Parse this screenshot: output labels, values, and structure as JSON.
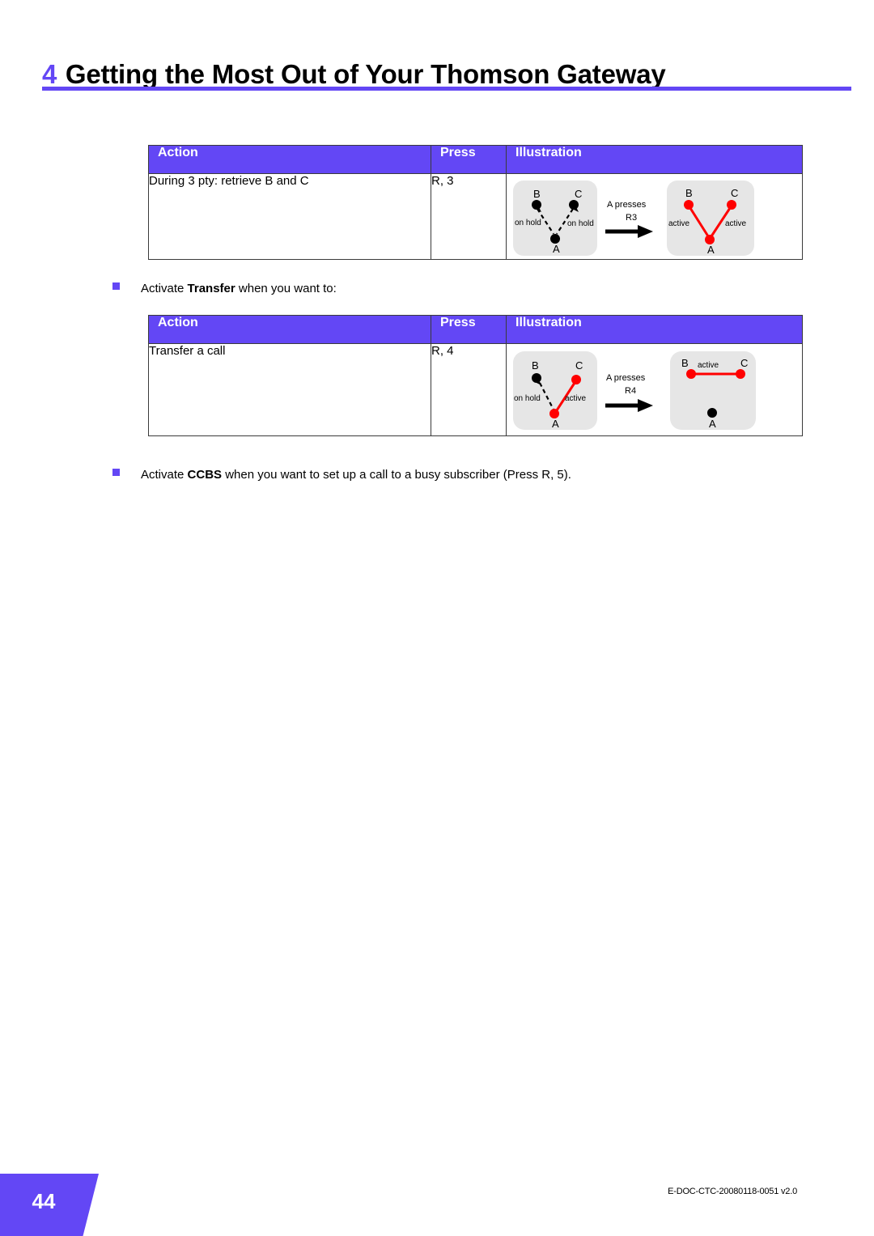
{
  "header": {
    "chapter_number": "4",
    "title": "Getting the Most Out of Your Thomson Gateway",
    "accent_color": "#6347F5"
  },
  "tables": [
    {
      "id": "table-1",
      "columns": [
        "Action",
        "Press",
        "Illustration"
      ],
      "rows": [
        {
          "action": "During 3 pty: retrieve B and C",
          "press": "R, 3",
          "illustration": {
            "before": {
              "nodes": [
                "B",
                "C",
                "A"
              ],
              "edge_labels": [
                "on hold",
                "on hold"
              ],
              "state": "B and C on hold with A"
            },
            "transition": {
              "line1": "A presses",
              "line2": "R3"
            },
            "after": {
              "nodes": [
                "B",
                "C",
                "A"
              ],
              "edge_labels": [
                "active",
                "active"
              ],
              "state": "B and C active with A"
            }
          }
        }
      ]
    },
    {
      "id": "table-2",
      "columns": [
        "Action",
        "Press",
        "Illustration"
      ],
      "rows": [
        {
          "action": "Transfer a call",
          "press": "R, 4",
          "illustration": {
            "before": {
              "nodes": [
                "B",
                "C",
                "A"
              ],
              "edge_labels": [
                "on hold",
                "active"
              ],
              "state": "B on hold, C active with A"
            },
            "transition": {
              "line1": "A presses",
              "line2": "R4"
            },
            "after": {
              "nodes": [
                "B",
                "C",
                "A"
              ],
              "edge_labels": [
                "active"
              ],
              "state": "B and C active, A released"
            }
          }
        }
      ]
    }
  ],
  "bullets": [
    {
      "prefix": "Activate ",
      "emphasis": "Transfer",
      "suffix": " when you want to:"
    },
    {
      "prefix": "Activate ",
      "emphasis": "CCBS",
      "suffix": " when you want to set up a call to a busy subscriber (Press R, 5)."
    }
  ],
  "footer": {
    "page_number": "44",
    "doc_reference": "E-DOC-CTC-20080118-0051 v2.0"
  },
  "colors": {
    "accent_purple": "#6347F5",
    "active_red": "#FF0000",
    "onhold_black": "#000000",
    "panel_gray": "#E6E6E6"
  }
}
